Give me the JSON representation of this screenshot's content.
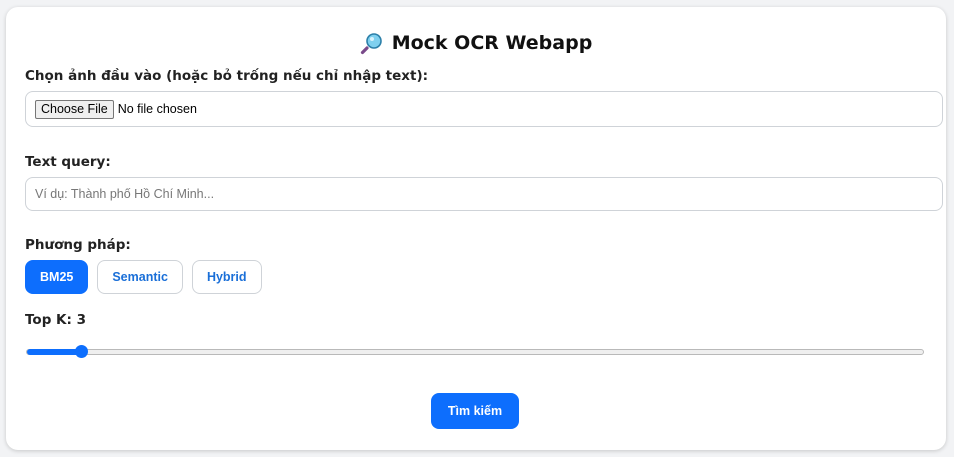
{
  "app": {
    "title": "Mock OCR Webapp",
    "title_icon": "magnifying-glass-icon"
  },
  "image_input": {
    "label": "Chọn ảnh đầu vào (hoặc bỏ trống nếu chỉ nhập text):",
    "button_label": "Choose File",
    "status": "No file chosen"
  },
  "text_query": {
    "label": "Text query:",
    "value": "",
    "placeholder": "Ví dụ: Thành phố Hồ Chí Minh..."
  },
  "method": {
    "label": "Phương pháp:",
    "options": [
      "BM25",
      "Semantic",
      "Hybrid"
    ],
    "selected": "BM25"
  },
  "top_k": {
    "label": "Top K: 3",
    "value": 3,
    "fraction": 0.06
  },
  "submit": {
    "label": "Tìm kiếm"
  },
  "colors": {
    "accent": "#0d6efd",
    "method_text": "#1a6fd8"
  }
}
